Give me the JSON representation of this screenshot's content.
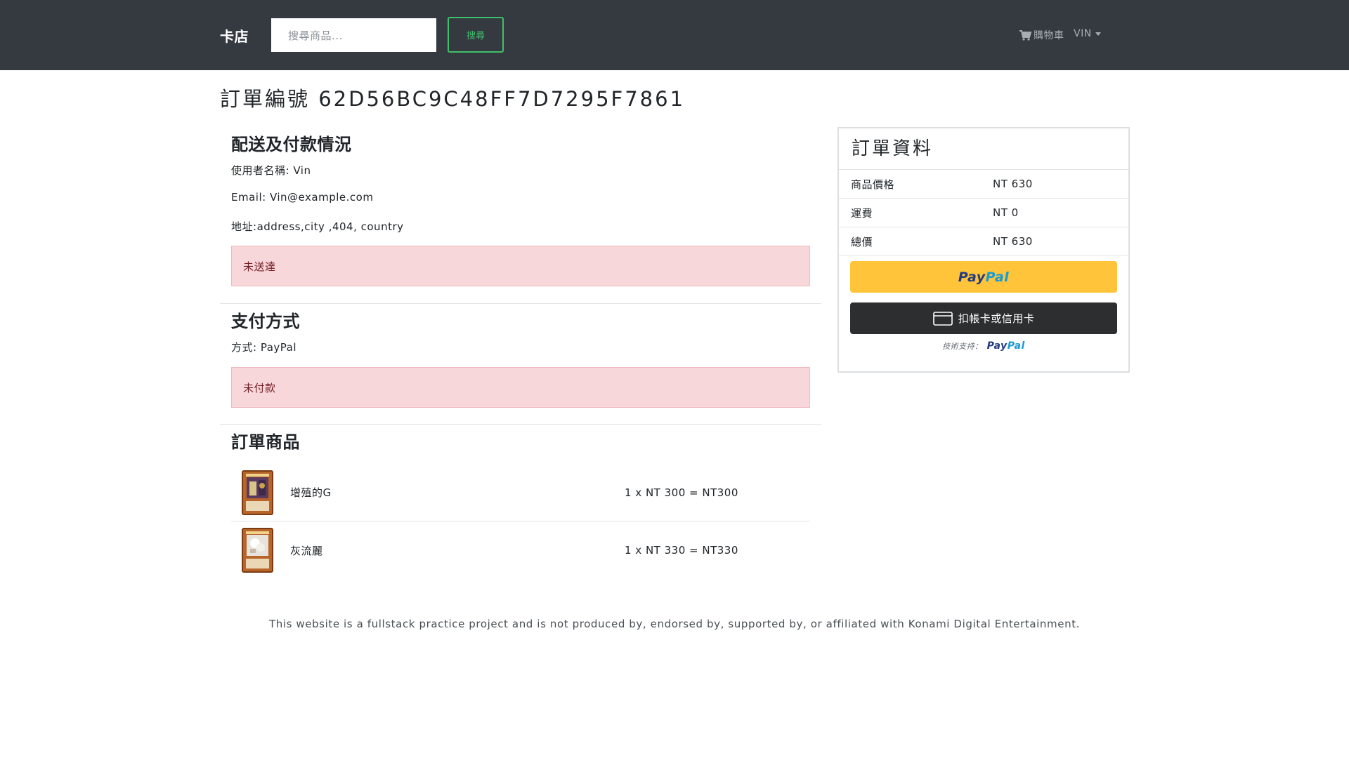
{
  "navbar": {
    "brand": "卡店",
    "search_placeholder": "搜尋商品...",
    "search_button": "搜尋",
    "cart_label": "購物車",
    "user_label": "VIN"
  },
  "order": {
    "title": "訂單編號 62D56BC9C48FF7D7295F7861"
  },
  "shipping": {
    "heading": "配送及付款情況",
    "username_label": "使用者名稱:",
    "username_value": "Vin",
    "email_label": "Email:",
    "email_value": "Vin@example.com",
    "address_label": "地址:",
    "address_value": "address,city ,404, country",
    "status": "未送達"
  },
  "payment": {
    "heading": "支付方式",
    "method_label": "方式:",
    "method_value": "PayPal",
    "status": "未付款"
  },
  "items": {
    "heading": "訂單商品",
    "rows": [
      {
        "name": "增殖的G",
        "price": "1 x NT 300 = NT300"
      },
      {
        "name": "灰流麗",
        "price": "1 x NT 330 = NT330"
      }
    ]
  },
  "summary": {
    "heading": "訂單資料",
    "rows": [
      {
        "label": "商品價格",
        "value": "NT 630"
      },
      {
        "label": "運費",
        "value": "NT 0"
      },
      {
        "label": "總價",
        "value": "NT 630"
      }
    ],
    "paypal_pay": "Pay",
    "paypal_pal": "Pal",
    "card_button": "扣帳卡或信用卡",
    "powered_by": "技術支持：",
    "powered_pay": "Pay",
    "powered_pal": "Pal"
  },
  "footer": {
    "text": "This website is a fullstack practice project and is not produced by, endorsed by, supported by, or affiliated with Konami Digital Entertainment."
  },
  "colors": {
    "navbar_bg": "#343a40",
    "search_accent": "#3fbf6a",
    "alert_bg": "#f8d7da",
    "paypal_yellow": "#ffc439",
    "card_button_bg": "#2c2e2f"
  }
}
